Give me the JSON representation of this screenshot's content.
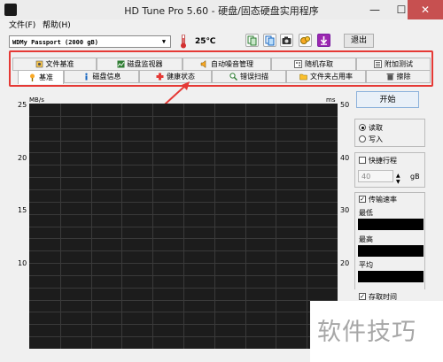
{
  "window": {
    "title": "HD Tune Pro 5.60 - 硬盘/固态硬盘实用程序",
    "minimize": "—",
    "maximize": "☐",
    "close": "✕"
  },
  "menu": {
    "items": [
      "文件(F)",
      "帮助(H)"
    ]
  },
  "toolbar": {
    "drive": "WDMy Passport (2000 gB)",
    "temperature": "25℃",
    "exit_label": "退出",
    "buttons": [
      "copy-icon",
      "copy-all-icon",
      "camera-icon",
      "options-icon",
      "download-icon"
    ]
  },
  "tabs": {
    "row1": [
      "文件基准",
      "磁盘监视器",
      "自动噪音管理",
      "随机存取",
      "附加测试"
    ],
    "row2": [
      "基准",
      "磁盘信息",
      "健康状态",
      "错误扫描",
      "文件夹占用率",
      "擦除"
    ],
    "selected": "基准"
  },
  "chart_data": {
    "type": "line",
    "ylabel_left": "MB/s",
    "ylabel_right": "ms",
    "y_left_ticks": [
      "25",
      "20",
      "15",
      "10"
    ],
    "y_right_ticks": [
      "50",
      "40",
      "30",
      "20"
    ],
    "series": []
  },
  "panel": {
    "start_label": "开始",
    "read_label": "读取",
    "write_label": "写入",
    "short_stroke_label": "快捷行程",
    "short_stroke_value": "40",
    "short_stroke_unit": "gB",
    "transfer_rate_label": "传输速率",
    "min_label": "最低",
    "max_label": "最高",
    "avg_label": "平均",
    "access_time_label": "存取时间",
    "read_selected": true,
    "transfer_rate_checked": true
  },
  "watermark": {
    "text": "软件技巧"
  },
  "colors": {
    "highlight": "#e53935",
    "plot_bg": "#1c1c1c"
  }
}
